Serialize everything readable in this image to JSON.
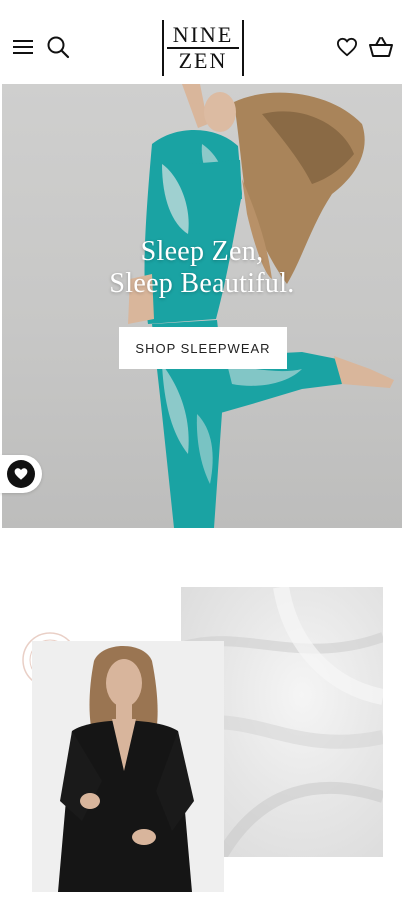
{
  "brand": {
    "logo_line1": "NINE",
    "logo_line2": "ZEN"
  },
  "header": {
    "icons": [
      "menu-icon",
      "search-icon",
      "heart-icon",
      "basket-icon"
    ]
  },
  "hero": {
    "headline_line1": "Sleep Zen,",
    "headline_line2": "Sleep Beautiful.",
    "cta_label": "SHOP SLEEPWEAR",
    "pajama_color": "#1aa3a3"
  },
  "colors": {
    "text": "#111111",
    "background": "#ffffff"
  }
}
